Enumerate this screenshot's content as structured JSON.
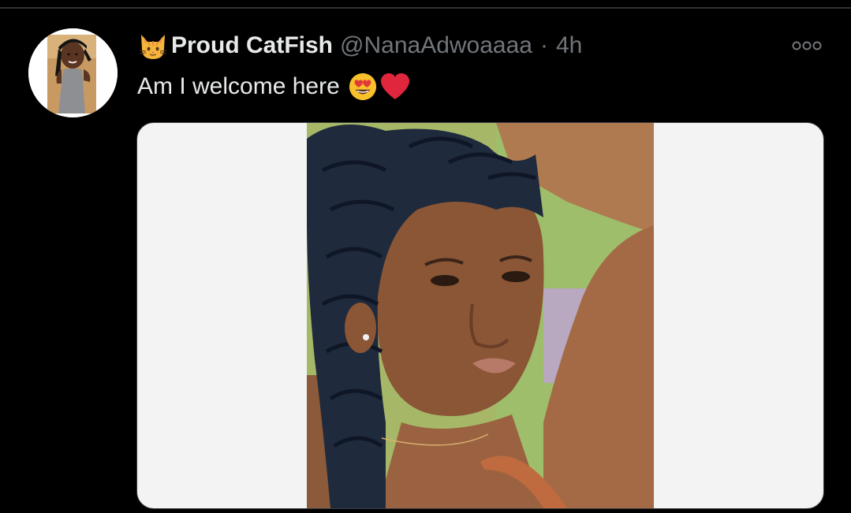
{
  "tweet": {
    "display_name": "Proud CatFish",
    "display_name_emoji": "cat-face-emoji",
    "handle": "@NanaAdwoaaaa",
    "separator": "·",
    "timestamp": "4h",
    "text": "Am I welcome here",
    "text_emojis": [
      "heart-eyes-emoji",
      "red-heart-emoji"
    ],
    "more_icon": "more-options-icon"
  },
  "colors": {
    "background": "#000000",
    "primary_text": "#e7e9ea",
    "secondary_text": "#71767b",
    "divider": "#2f3336",
    "media_border": "#3b3f44",
    "media_letterbox": "#f3f3f3"
  }
}
